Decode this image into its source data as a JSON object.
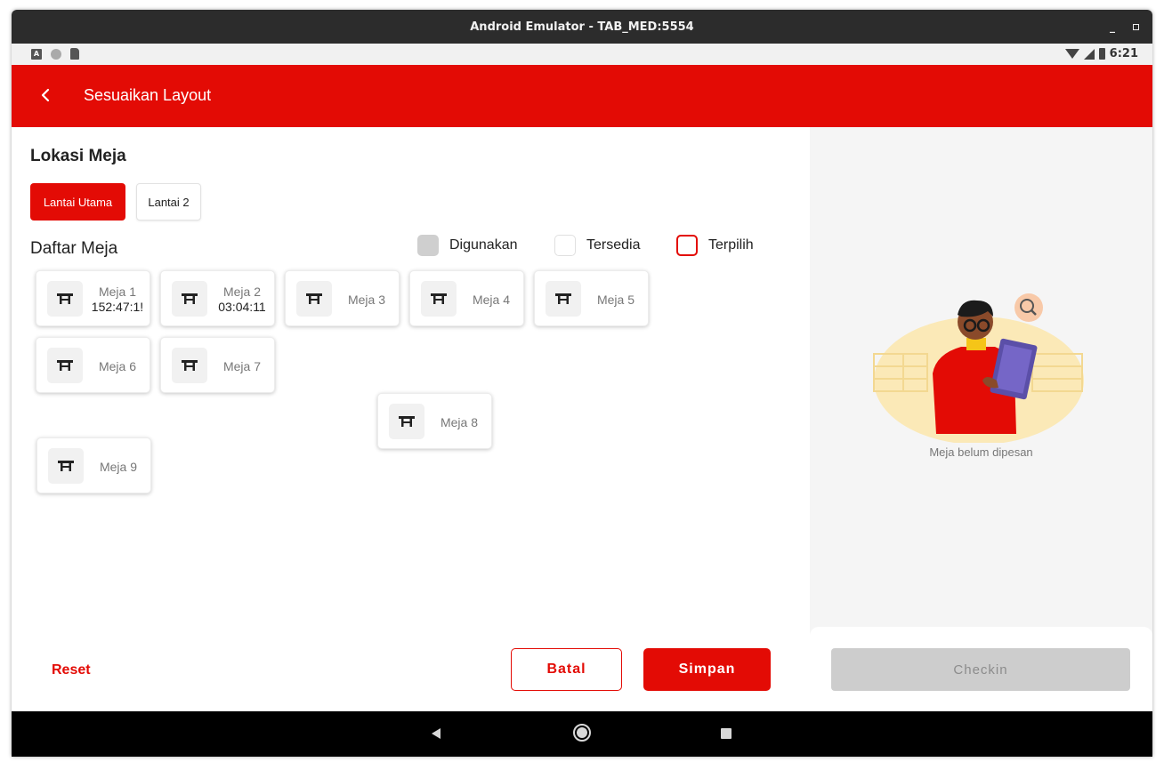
{
  "window": {
    "title": "Android Emulator - TAB_MED:5554"
  },
  "status_bar": {
    "time": "6:21"
  },
  "app_bar": {
    "title": "Sesuaikan Layout"
  },
  "location": {
    "title": "Lokasi Meja",
    "floors": [
      {
        "label": "Lantai Utama",
        "active": true
      },
      {
        "label": "Lantai 2",
        "active": false
      }
    ]
  },
  "table_list": {
    "title": "Daftar Meja",
    "legend": {
      "used": "Digunakan",
      "available": "Tersedia",
      "selected": "Terpilih"
    },
    "tables": [
      {
        "name": "Meja 1",
        "timer": "152:47:1!"
      },
      {
        "name": "Meja 2",
        "timer": "03:04:11"
      },
      {
        "name": "Meja 3",
        "timer": ""
      },
      {
        "name": "Meja 4",
        "timer": ""
      },
      {
        "name": "Meja 5",
        "timer": ""
      },
      {
        "name": "Meja 6",
        "timer": ""
      },
      {
        "name": "Meja 7",
        "timer": ""
      },
      {
        "name": "Meja 8",
        "timer": ""
      },
      {
        "name": "Meja 9",
        "timer": ""
      }
    ]
  },
  "actions": {
    "reset": "Reset",
    "cancel": "Batal",
    "save": "Simpan"
  },
  "side_panel": {
    "empty_text": "Meja belum dipesan",
    "checkin": "Checkin"
  },
  "colors": {
    "brand_red": "#e30b05",
    "used_gray": "#cfcfcf",
    "disabled_gray": "#cdcdcd"
  }
}
